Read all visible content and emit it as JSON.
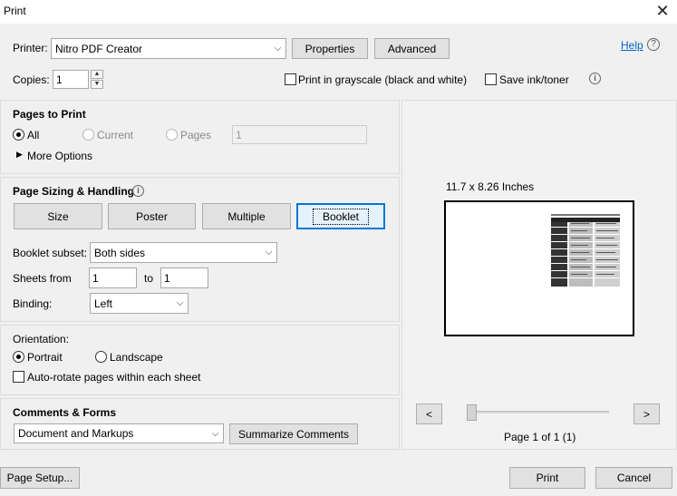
{
  "window": {
    "title": "Print",
    "close_glyph": "✕"
  },
  "printer": {
    "label": "Printer:",
    "selected": "Nitro PDF Creator",
    "properties_label": "Properties",
    "advanced_label": "Advanced",
    "help_label": "Help",
    "help_icon_glyph": "?"
  },
  "copies": {
    "label": "Copies:",
    "value": "1",
    "grayscale_label": "Print in grayscale (black and white)",
    "grayscale_checked": false,
    "save_ink_label": "Save ink/toner",
    "save_ink_checked": false,
    "info_glyph": "i"
  },
  "pages_to_print": {
    "title": "Pages to Print",
    "all_label": "All",
    "current_label": "Current",
    "pages_label": "Pages",
    "pages_value": "1",
    "selected": "All",
    "more_options_label": "More Options"
  },
  "page_sizing": {
    "title": "Page Sizing & Handling",
    "info_glyph": "i",
    "buttons": [
      "Size",
      "Poster",
      "Multiple",
      "Booklet"
    ],
    "active_button": "Booklet",
    "booklet_subset_label": "Booklet subset:",
    "booklet_subset_value": "Both sides",
    "sheets_from_label": "Sheets from",
    "sheets_from_value": "1",
    "to_label": "to",
    "sheets_to_value": "1",
    "binding_label": "Binding:",
    "binding_value": "Left"
  },
  "orientation": {
    "title": "Orientation:",
    "portrait_label": "Portrait",
    "landscape_label": "Landscape",
    "selected": "Portrait",
    "auto_rotate_label": "Auto-rotate pages within each sheet",
    "auto_rotate_checked": false
  },
  "comments_forms": {
    "title": "Comments & Forms",
    "selected": "Document and Markups",
    "summarize_label": "Summarize Comments"
  },
  "preview": {
    "size_text": "11.7 x 8.26 Inches",
    "prev_glyph": "<",
    "next_glyph": ">",
    "page_text": "Page 1 of 1 (1)"
  },
  "footer": {
    "page_setup_label": "Page Setup...",
    "print_label": "Print",
    "cancel_label": "Cancel"
  },
  "colors": {
    "accent": "#0078d7",
    "link": "#0066cc",
    "dialog_bg": "#f0f0f0",
    "button_bg": "#e1e1e1"
  }
}
